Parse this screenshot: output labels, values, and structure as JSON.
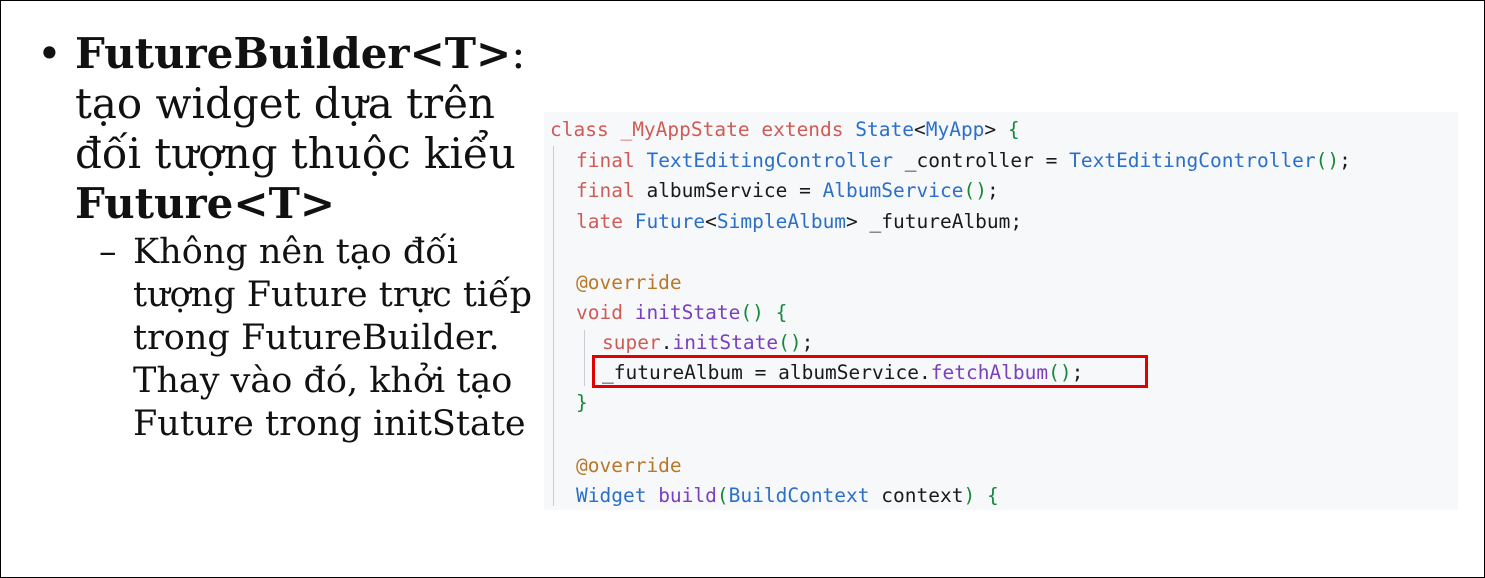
{
  "bullet": {
    "marker": "•",
    "title_part1": "FutureBuilder<T>",
    "title_colon": ":",
    "desc_line1": "tạo widget dựa trên",
    "desc_line2": "đối tượng thuộc kiểu",
    "desc_type": "Future<T>"
  },
  "sub_bullet": {
    "marker": "–",
    "lines": [
      "Không nên tạo đối",
      "tượng Future trực tiếp",
      "trong FutureBuilder.",
      "Thay vào đó, khởi tạo",
      "Future trong initState"
    ]
  },
  "code": {
    "l1": {
      "kw": "class ",
      "name": "_MyAppState ",
      "kw2": "extends ",
      "cls": "State",
      "lt": "<",
      "gen": "MyApp",
      "gt": "> ",
      "brace": "{"
    },
    "l2": {
      "kw": "final ",
      "cls": "TextEditingController",
      "var": " _controller = ",
      "cls2": "TextEditingController",
      "paren": "()",
      "semi": ";"
    },
    "l3": {
      "kw": "final ",
      "var": "albumService = ",
      "cls": "AlbumService",
      "paren": "()",
      "semi": ";"
    },
    "l4": {
      "kw": "late ",
      "cls": "Future",
      "lt": "<",
      "gen": "SimpleAlbum",
      "rest": "> _futureAlbum;"
    },
    "l5": {
      "ann": "@override"
    },
    "l6": {
      "kw": "void ",
      "fn": "initState",
      "paren": "() ",
      "brace": "{"
    },
    "l7": {
      "kw": "super",
      "dot": ".",
      "fn": "initState",
      "paren": "()",
      "semi": ";"
    },
    "l8": {
      "var": "_futureAlbum = albumService.",
      "fn": "fetchAlbum",
      "paren": "()",
      "semi": ";"
    },
    "l9": {
      "brace": "}"
    },
    "l10": {
      "ann": "@override"
    },
    "l11": {
      "cls": "Widget ",
      "fn": "build",
      "paren": "(",
      "cls2": "BuildContext",
      "var": " context",
      "paren2": ") ",
      "brace": "{"
    }
  }
}
